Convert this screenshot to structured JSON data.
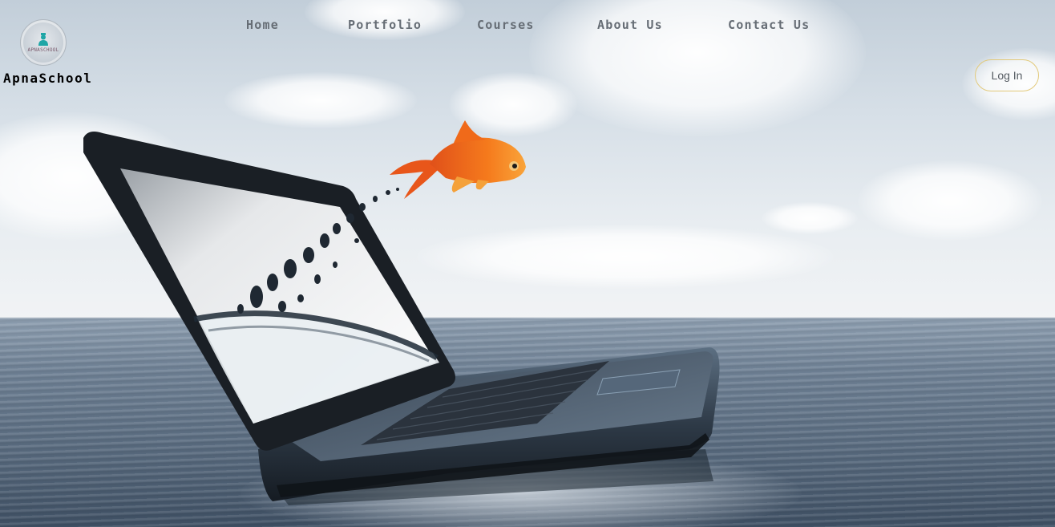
{
  "brand": {
    "name": "ApnaSchool",
    "badge_text": "APNASCHOOL",
    "badge_icon": "student-figure-icon",
    "accent": "#1fa6a6"
  },
  "nav": {
    "items": [
      {
        "label": "Home"
      },
      {
        "label": "Portfolio"
      },
      {
        "label": "Courses"
      },
      {
        "label": "About Us"
      },
      {
        "label": "Contact Us"
      }
    ]
  },
  "auth": {
    "login_label": "Log In",
    "border_color": "#e2c97a"
  },
  "hero": {
    "image_subject": "laptop-in-sea-with-goldfish"
  }
}
